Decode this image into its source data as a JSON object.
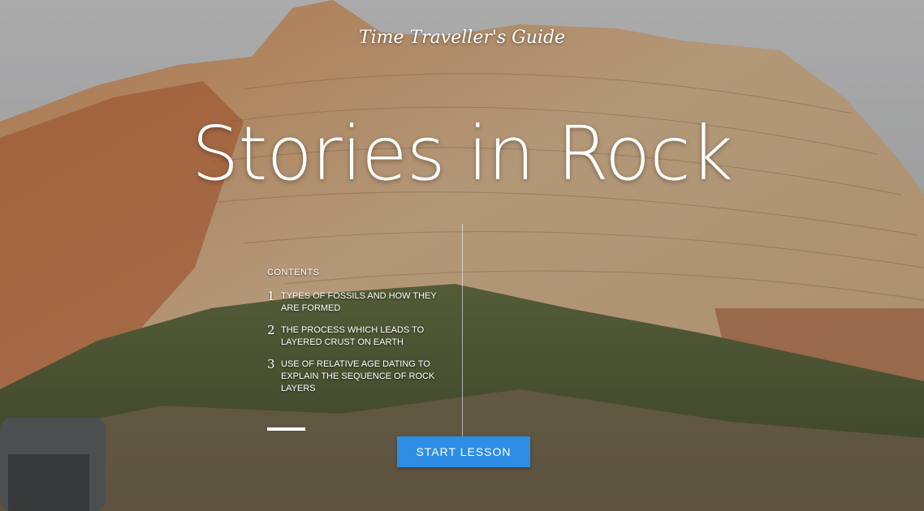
{
  "header": {
    "guide_label": "Time Traveller's Guide"
  },
  "hero": {
    "title": "Stories in Rock"
  },
  "contents": {
    "label": "CONTENTS",
    "items": [
      {
        "number": "1",
        "text": "TYPES OF FOSSILS AND HOW THEY ARE FORMED"
      },
      {
        "number": "2",
        "text": "THE PROCESS WHICH LEADS TO LAYERED CRUST ON EARTH"
      },
      {
        "number": "3",
        "text": "USE OF RELATIVE AGE DATING TO EXPLAIN THE SEQUENCE OF ROCK LAYERS"
      }
    ]
  },
  "actions": {
    "start_label": "START LESSON"
  },
  "colors": {
    "button": "#2e8ee6",
    "text": "#ffffff"
  }
}
